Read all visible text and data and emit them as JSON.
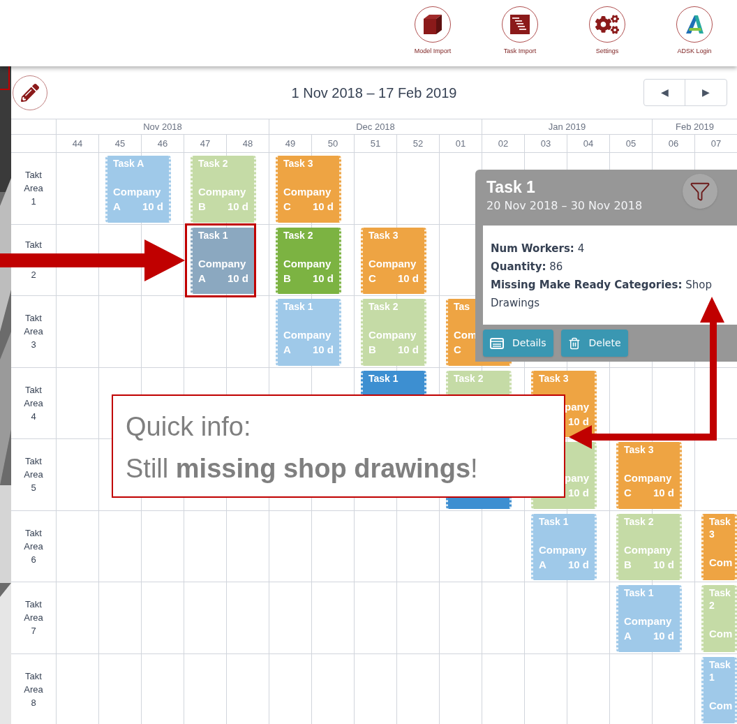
{
  "toolbar": {
    "buttons": [
      {
        "label": "Model Import",
        "kind": "cube"
      },
      {
        "label": "Task Import",
        "kind": "stack"
      },
      {
        "label": "Settings",
        "kind": "gears"
      },
      {
        "label": "ADSK Login",
        "kind": "logo"
      }
    ]
  },
  "header": {
    "date_range": "1 Nov 2018 – 17 Feb 2019",
    "prev": "◀",
    "next": "▶"
  },
  "months": [
    {
      "label": "Nov 2018",
      "weeks": [
        "44",
        "45",
        "46",
        "47",
        "48"
      ]
    },
    {
      "label": "Dec 2018",
      "weeks": [
        "49",
        "50",
        "51",
        "52",
        "01"
      ]
    },
    {
      "label": "Jan 2019",
      "weeks": [
        "02",
        "03",
        "04",
        "05"
      ]
    },
    {
      "label": "Feb 2019",
      "weeks": [
        "06",
        "07"
      ]
    }
  ],
  "rows": [
    {
      "label": [
        "Takt",
        "Area",
        "1"
      ],
      "kind": "full",
      "slots": [
        {
          "kind": "task",
          "color": "#9fc9e9",
          "title": "Task A",
          "company": "Company",
          "code": "A",
          "duration": "10 d"
        },
        {
          "kind": "task",
          "color": "#c5dba6",
          "title": "Task 2",
          "company": "Company",
          "code": "B",
          "duration": "10 d"
        },
        {
          "kind": "task",
          "color": "#eea443",
          "title": "Task 3",
          "company": "Company",
          "code": "C",
          "duration": "10 d"
        }
      ]
    },
    {
      "label": [
        "Takt",
        "2"
      ],
      "kind": "split",
      "slots": [
        {
          "kind": "empty"
        },
        {
          "kind": "task",
          "color": "#8ba8c0",
          "title": "Task 1",
          "company": "Company",
          "code": "A",
          "duration": "10 d"
        },
        {
          "kind": "task",
          "color": "#7cb342",
          "title": "Task 2",
          "company": "Company",
          "code": "B",
          "duration": "10 d"
        },
        {
          "kind": "task",
          "color": "#eea443",
          "title": "Task 3",
          "company": "Company",
          "code": "C",
          "duration": "10 d"
        }
      ]
    },
    {
      "label": [
        "Takt",
        "Area",
        "3"
      ],
      "kind": "full",
      "slots": [
        {
          "kind": "empty"
        },
        {
          "kind": "empty"
        },
        {
          "kind": "task",
          "color": "#9fc9e9",
          "title": "Task 1",
          "company": "Company",
          "code": "A",
          "duration": "10 d"
        },
        {
          "kind": "task",
          "color": "#c5dba6",
          "title": "Task 2",
          "company": "Company",
          "code": "B",
          "duration": "10 d"
        },
        {
          "kind": "task",
          "color": "#eea443",
          "title": "Tas",
          "company": "Com",
          "code": "C"
        }
      ]
    },
    {
      "label": [
        "Takt",
        "Area",
        "4"
      ],
      "kind": "full",
      "slots": [
        {
          "kind": "empty"
        },
        {
          "kind": "empty"
        },
        {
          "kind": "empty"
        },
        {
          "kind": "task",
          "color": "#3d8fd1",
          "title": "Task 1"
        },
        {
          "kind": "task",
          "color": "#c5dba6",
          "title": "Task 2"
        },
        {
          "kind": "task",
          "color": "#eea443",
          "title": "Task 3",
          "company": "pany",
          "duration": "10 d",
          "covered": true
        }
      ]
    },
    {
      "label": [
        "Takt",
        "Area",
        "5"
      ],
      "kind": "full",
      "slots": [
        {
          "kind": "empty"
        },
        {
          "kind": "empty"
        },
        {
          "kind": "empty"
        },
        {
          "kind": "empty"
        },
        {
          "kind": "task",
          "color": "#3d8fd1"
        },
        {
          "kind": "task",
          "color": "#c5dba6",
          "company": "pany",
          "duration": "10 d",
          "covered": true
        },
        {
          "kind": "task",
          "color": "#eea443",
          "title": "Task 3",
          "company": "Company",
          "code": "C",
          "duration": "10 d"
        }
      ]
    },
    {
      "label": [
        "Takt",
        "Area",
        "6"
      ],
      "kind": "full",
      "slots": [
        {
          "kind": "empty"
        },
        {
          "kind": "empty"
        },
        {
          "kind": "empty"
        },
        {
          "kind": "empty"
        },
        {
          "kind": "empty"
        },
        {
          "kind": "task",
          "color": "#9fc9e9",
          "title": "Task 1",
          "company": "Company",
          "code": "A",
          "duration": "10 d"
        },
        {
          "kind": "task",
          "color": "#c5dba6",
          "title": "Task 2",
          "company": "Company",
          "code": "B",
          "duration": "10 d"
        },
        {
          "kind": "task",
          "color": "#eea443",
          "title": "Task 3",
          "company": "Com"
        }
      ]
    },
    {
      "label": [
        "Takt",
        "Area",
        "7"
      ],
      "kind": "full",
      "slots": [
        {
          "kind": "empty"
        },
        {
          "kind": "empty"
        },
        {
          "kind": "empty"
        },
        {
          "kind": "empty"
        },
        {
          "kind": "empty"
        },
        {
          "kind": "empty"
        },
        {
          "kind": "task",
          "color": "#9fc9e9",
          "title": "Task 1",
          "company": "Company",
          "code": "A",
          "duration": "10 d"
        },
        {
          "kind": "task",
          "color": "#c5dba6",
          "title": "Task 2",
          "company": "Com"
        }
      ]
    },
    {
      "label": [
        "Takt",
        "Area",
        "8"
      ],
      "kind": "full",
      "slots": [
        {
          "kind": "empty"
        },
        {
          "kind": "empty"
        },
        {
          "kind": "empty"
        },
        {
          "kind": "empty"
        },
        {
          "kind": "empty"
        },
        {
          "kind": "empty"
        },
        {
          "kind": "empty"
        },
        {
          "kind": "task",
          "color": "#9fc9e9",
          "title": "Task 1",
          "company": "Com"
        }
      ]
    }
  ],
  "popup": {
    "title": "Task 1",
    "dates": "20 Nov 2018 – 30 Nov 2018",
    "lines": [
      "**Num Workers:** 4",
      "**Quantity:** 86",
      "**Missing Make Ready Categories:** Shop Drawings"
    ],
    "buttons": [
      {
        "label": "Details",
        "kind": "details"
      },
      {
        "label": "Delete",
        "kind": "delete"
      }
    ]
  },
  "callout": {
    "lines": [
      "Quick info:",
      "Still **missing shop drawings**!"
    ]
  }
}
